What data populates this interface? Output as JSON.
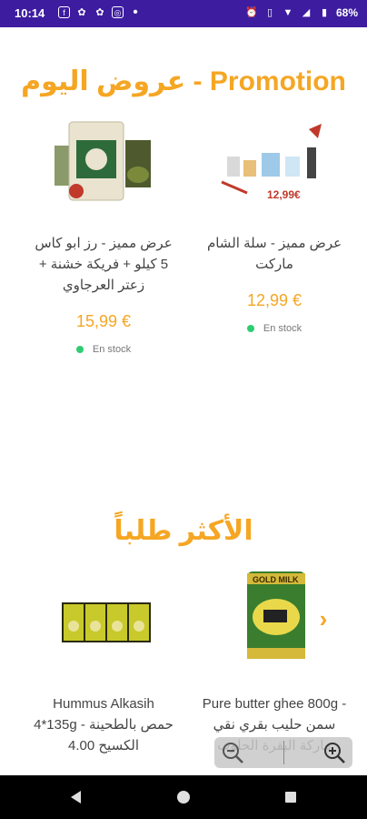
{
  "status_bar": {
    "time": "10:14",
    "battery": "68%"
  },
  "promo": {
    "title": "عروض اليوم - Promotion",
    "products": [
      {
        "name": "عرض مميز - سلة الشام ماركت",
        "price": "12,99 €",
        "stock": "En stock",
        "image_badge": "12,99€"
      },
      {
        "name": "عرض مميز - رز ابو كاس 5 كيلو + فريكة خشنة + زعتر العرجاوي",
        "price": "15,99 €",
        "stock": "En stock"
      }
    ]
  },
  "popular": {
    "title": "الأكثر طلباً",
    "products": [
      {
        "name": "Pure butter ghee 800g - سمن حليب بقري نقي ماركة البقرة الحلوب",
        "image_label": "GOLD MILK"
      },
      {
        "name": "Hummus Alkasih 4*135g - حمص بالطحينة الكسيح 4.00"
      }
    ]
  },
  "colors": {
    "accent": "#f5a623",
    "status_bar": "#3d1ca0",
    "in_stock": "#2ecc71"
  }
}
